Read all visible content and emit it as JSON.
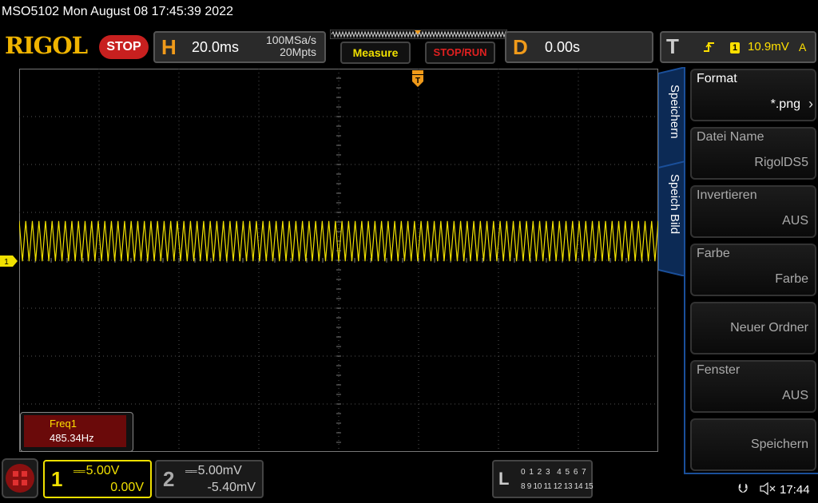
{
  "title_bar": "MSO5102  Mon August 08 17:45:39 2022",
  "brand": {
    "logo": "RIGOL",
    "run_state": "STOP"
  },
  "horizontal": {
    "letter": "H",
    "timebase": "20.0ms",
    "sample_rate": "100MSa/s",
    "memory_depth": "20Mpts"
  },
  "buttons": {
    "measure": "Measure",
    "stop_run": "STOP/RUN"
  },
  "delay": {
    "letter": "D",
    "value": "0.00s"
  },
  "trigger": {
    "letter": "T",
    "edge_icon": "rising-edge-icon",
    "source": "1",
    "level": "10.9mV",
    "mode": "A"
  },
  "markers": {
    "trigger": "T",
    "channel1": "1"
  },
  "waveform": {
    "channel": "1",
    "color": "#f0e000",
    "cycles_visible": 97,
    "peak_high_div": 0.42,
    "peak_low_div": -0.42,
    "center_div": 0.4
  },
  "measurement": {
    "label": "Freq1",
    "value": "485.34Hz"
  },
  "side_menu": {
    "tabs": [
      "Speichern",
      "Speich Bild"
    ],
    "items": [
      {
        "title": "Format",
        "value": "*.png"
      },
      {
        "title": "Datei Name",
        "value": "RigolDS5"
      },
      {
        "title": "Invertieren",
        "value": "AUS"
      },
      {
        "title": "Farbe",
        "value": "Farbe"
      },
      {
        "title": "",
        "value": "Neuer Ordner"
      },
      {
        "title": "Fenster",
        "value": "AUS"
      },
      {
        "title": "",
        "value": "Speichern"
      }
    ]
  },
  "channel1": {
    "number": "1",
    "scale": "5.00V",
    "offset": "0.00V",
    "color": "#f0e000"
  },
  "channel2": {
    "number": "2",
    "scale": "5.00mV",
    "offset": "-5.40mV"
  },
  "logic_analyzer": {
    "letter": "L",
    "row1": "0 1 2 3  4 5 6 7",
    "row2": "8 9 10 11 12 13 14 15"
  },
  "status": {
    "clock": "17:44"
  }
}
